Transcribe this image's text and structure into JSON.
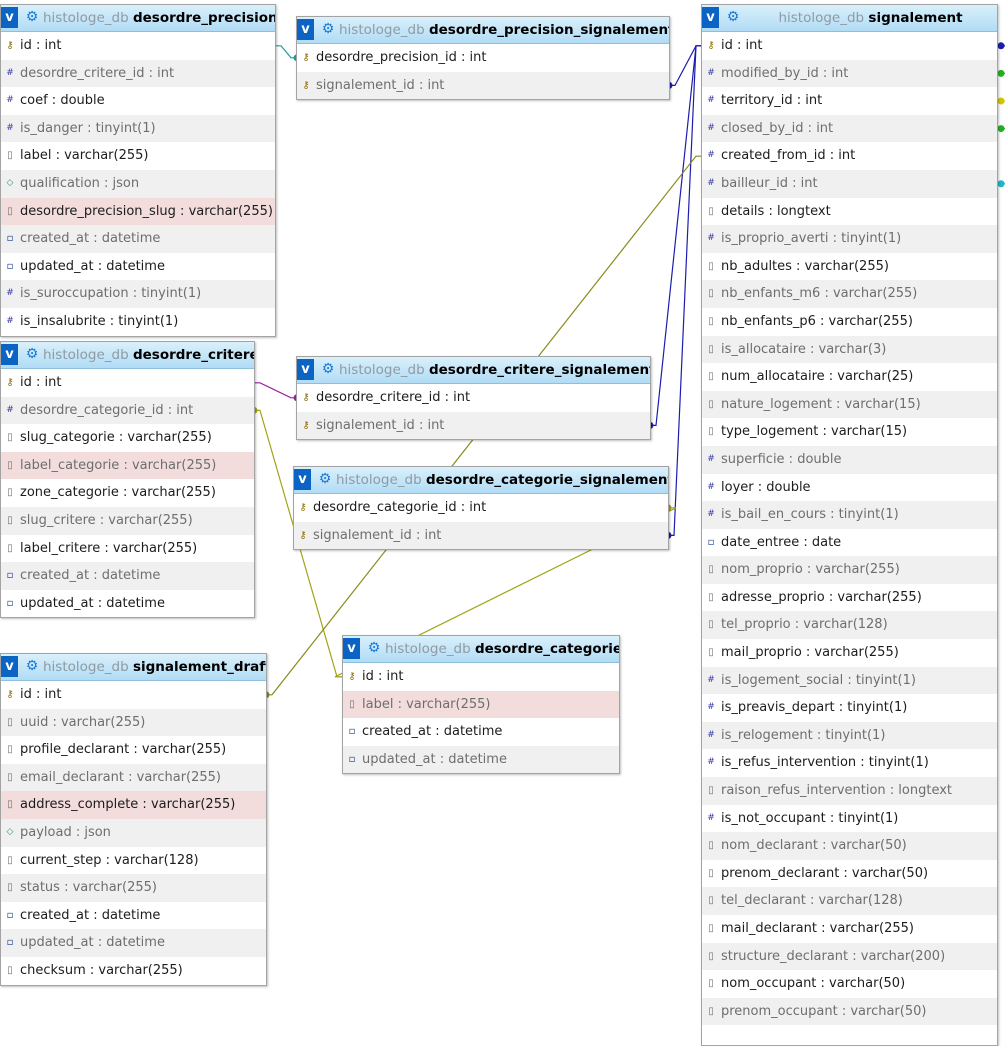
{
  "diagram": {
    "tables": [
      {
        "id": "desordre_precision",
        "db": "histologe_db",
        "name": "desordre_precision",
        "expand_label": "v",
        "columns": [
          {
            "text": "id : int",
            "icon": "key-icon"
          },
          {
            "text": "desordre_critere_id : int",
            "icon": "hash-icon"
          },
          {
            "text": "coef : double",
            "icon": "hash-icon"
          },
          {
            "text": "is_danger : tinyint(1)",
            "icon": "hash-icon"
          },
          {
            "text": "label : varchar(255)",
            "icon": "string-icon"
          },
          {
            "text": "qualification : json",
            "icon": "json-icon"
          },
          {
            "text": "desordre_precision_slug : varchar(255)",
            "icon": "string-icon",
            "highlight": true
          },
          {
            "text": "created_at : datetime",
            "icon": "datetime-icon"
          },
          {
            "text": "updated_at : datetime",
            "icon": "datetime-icon"
          },
          {
            "text": "is_suroccupation : tinyint(1)",
            "icon": "hash-icon"
          },
          {
            "text": "is_insalubrite : tinyint(1)",
            "icon": "hash-icon"
          }
        ]
      },
      {
        "id": "desordre_precision_signalement",
        "db": "histologe_db",
        "name": "desordre_precision_signalement",
        "expand_label": "v",
        "columns": [
          {
            "text": "desordre_precision_id : int",
            "icon": "key-icon"
          },
          {
            "text": "signalement_id : int",
            "icon": "key-icon"
          }
        ]
      },
      {
        "id": "signalement",
        "db": "histologe_db",
        "name": "signalement",
        "expand_label": "v",
        "columns": [
          {
            "text": "id : int",
            "icon": "key-icon"
          },
          {
            "text": "modified_by_id : int",
            "icon": "hash-icon"
          },
          {
            "text": "territory_id : int",
            "icon": "hash-icon"
          },
          {
            "text": "closed_by_id : int",
            "icon": "hash-icon"
          },
          {
            "text": "created_from_id : int",
            "icon": "hash-icon"
          },
          {
            "text": "bailleur_id : int",
            "icon": "hash-icon"
          },
          {
            "text": "details : longtext",
            "icon": "string-icon"
          },
          {
            "text": "is_proprio_averti : tinyint(1)",
            "icon": "hash-icon"
          },
          {
            "text": "nb_adultes : varchar(255)",
            "icon": "string-icon"
          },
          {
            "text": "nb_enfants_m6 : varchar(255)",
            "icon": "string-icon"
          },
          {
            "text": "nb_enfants_p6 : varchar(255)",
            "icon": "string-icon"
          },
          {
            "text": "is_allocataire : varchar(3)",
            "icon": "string-icon"
          },
          {
            "text": "num_allocataire : varchar(25)",
            "icon": "string-icon"
          },
          {
            "text": "nature_logement : varchar(15)",
            "icon": "string-icon"
          },
          {
            "text": "type_logement : varchar(15)",
            "icon": "string-icon"
          },
          {
            "text": "superficie : double",
            "icon": "hash-icon"
          },
          {
            "text": "loyer : double",
            "icon": "hash-icon"
          },
          {
            "text": "is_bail_en_cours : tinyint(1)",
            "icon": "hash-icon"
          },
          {
            "text": "date_entree : date",
            "icon": "datetime-icon"
          },
          {
            "text": "nom_proprio : varchar(255)",
            "icon": "string-icon"
          },
          {
            "text": "adresse_proprio : varchar(255)",
            "icon": "string-icon"
          },
          {
            "text": "tel_proprio : varchar(128)",
            "icon": "string-icon"
          },
          {
            "text": "mail_proprio : varchar(255)",
            "icon": "string-icon"
          },
          {
            "text": "is_logement_social : tinyint(1)",
            "icon": "hash-icon"
          },
          {
            "text": "is_preavis_depart : tinyint(1)",
            "icon": "hash-icon"
          },
          {
            "text": "is_relogement : tinyint(1)",
            "icon": "hash-icon"
          },
          {
            "text": "is_refus_intervention : tinyint(1)",
            "icon": "hash-icon"
          },
          {
            "text": "raison_refus_intervention : longtext",
            "icon": "string-icon"
          },
          {
            "text": "is_not_occupant : tinyint(1)",
            "icon": "hash-icon"
          },
          {
            "text": "nom_declarant : varchar(50)",
            "icon": "string-icon"
          },
          {
            "text": "prenom_declarant : varchar(50)",
            "icon": "string-icon"
          },
          {
            "text": "tel_declarant : varchar(128)",
            "icon": "string-icon"
          },
          {
            "text": "mail_declarant : varchar(255)",
            "icon": "string-icon"
          },
          {
            "text": "structure_declarant : varchar(200)",
            "icon": "string-icon"
          },
          {
            "text": "nom_occupant : varchar(50)",
            "icon": "string-icon"
          },
          {
            "text": "prenom_occupant : varchar(50)",
            "icon": "string-icon"
          }
        ]
      },
      {
        "id": "desordre_critere",
        "db": "histologe_db",
        "name": "desordre_critere",
        "expand_label": "v",
        "columns": [
          {
            "text": "id : int",
            "icon": "key-icon"
          },
          {
            "text": "desordre_categorie_id : int",
            "icon": "hash-icon"
          },
          {
            "text": "slug_categorie : varchar(255)",
            "icon": "string-icon"
          },
          {
            "text": "label_categorie : varchar(255)",
            "icon": "string-icon",
            "highlight": true
          },
          {
            "text": "zone_categorie : varchar(255)",
            "icon": "string-icon"
          },
          {
            "text": "slug_critere : varchar(255)",
            "icon": "string-icon"
          },
          {
            "text": "label_critere : varchar(255)",
            "icon": "string-icon"
          },
          {
            "text": "created_at : datetime",
            "icon": "datetime-icon"
          },
          {
            "text": "updated_at : datetime",
            "icon": "datetime-icon"
          }
        ]
      },
      {
        "id": "desordre_critere_signalement",
        "db": "histologe_db",
        "name": "desordre_critere_signalement",
        "expand_label": "v",
        "columns": [
          {
            "text": "desordre_critere_id : int",
            "icon": "key-icon"
          },
          {
            "text": "signalement_id : int",
            "icon": "key-icon"
          }
        ]
      },
      {
        "id": "desordre_categorie_signalement",
        "db": "histologe_db",
        "name": "desordre_categorie_signalement",
        "expand_label": "v",
        "columns": [
          {
            "text": "desordre_categorie_id : int",
            "icon": "key-icon"
          },
          {
            "text": "signalement_id : int",
            "icon": "key-icon"
          }
        ]
      },
      {
        "id": "signalement_draft",
        "db": "histologe_db",
        "name": "signalement_draft",
        "expand_label": "v",
        "columns": [
          {
            "text": "id : int",
            "icon": "key-icon"
          },
          {
            "text": "uuid : varchar(255)",
            "icon": "string-icon"
          },
          {
            "text": "profile_declarant : varchar(255)",
            "icon": "string-icon"
          },
          {
            "text": "email_declarant : varchar(255)",
            "icon": "string-icon"
          },
          {
            "text": "address_complete : varchar(255)",
            "icon": "string-icon",
            "highlight": true
          },
          {
            "text": "payload : json",
            "icon": "json-icon"
          },
          {
            "text": "current_step : varchar(128)",
            "icon": "string-icon"
          },
          {
            "text": "status : varchar(255)",
            "icon": "string-icon"
          },
          {
            "text": "created_at : datetime",
            "icon": "datetime-icon"
          },
          {
            "text": "updated_at : datetime",
            "icon": "datetime-icon"
          },
          {
            "text": "checksum : varchar(255)",
            "icon": "string-icon"
          }
        ]
      },
      {
        "id": "desordre_categorie",
        "db": "histologe_db",
        "name": "desordre_categorie",
        "expand_label": "v",
        "columns": [
          {
            "text": "id : int",
            "icon": "key-icon"
          },
          {
            "text": "label : varchar(255)",
            "icon": "string-icon",
            "highlight": true
          },
          {
            "text": "created_at : datetime",
            "icon": "datetime-icon"
          },
          {
            "text": "updated_at : datetime",
            "icon": "datetime-icon"
          }
        ]
      }
    ],
    "relations": [
      {
        "from": "desordre_precision_signalement",
        "from_column": "desordre_precision_id : int",
        "to": "desordre_precision",
        "to_column": "id : int",
        "color": "#1a9e9a"
      },
      {
        "from": "desordre_precision_signalement",
        "from_column": "signalement_id : int",
        "to": "signalement",
        "to_column": "id : int",
        "color": "#1c1cb0"
      },
      {
        "from": "desordre_critere_signalement",
        "from_column": "desordre_critere_id : int",
        "to": "desordre_critere",
        "to_column": "id : int",
        "color": "#9a1fa0"
      },
      {
        "from": "desordre_critere_signalement",
        "from_column": "signalement_id : int",
        "to": "signalement",
        "to_column": "id : int",
        "color": "#1c1cb0"
      },
      {
        "from": "desordre_categorie_signalement",
        "from_column": "signalement_id : int",
        "to": "signalement",
        "to_column": "id : int",
        "color": "#1c1cb0"
      },
      {
        "from": "desordre_categorie_signalement",
        "from_column": "desordre_categorie_id : int",
        "to": "desordre_categorie",
        "to_column": "id : int",
        "color": "#a3a31a"
      },
      {
        "from": "desordre_critere",
        "from_column": "desordre_categorie_id : int",
        "to": "desordre_categorie",
        "to_column": "id : int",
        "color": "#a3a31a"
      },
      {
        "from": "signalement_draft",
        "from_column": "id : int",
        "to": "signalement",
        "to_column": "created_from_id : int",
        "color": "#8a8a1a"
      }
    ],
    "offscreen_links": [
      {
        "column": "id : int",
        "color": "#1c1cb0"
      },
      {
        "column": "modified_by_id : int",
        "color": "#22b022"
      },
      {
        "column": "territory_id : int",
        "color": "#d4c400"
      },
      {
        "column": "closed_by_id : int",
        "color": "#22b022"
      },
      {
        "column": "bailleur_id : int",
        "color": "#1ab8c8"
      }
    ]
  }
}
